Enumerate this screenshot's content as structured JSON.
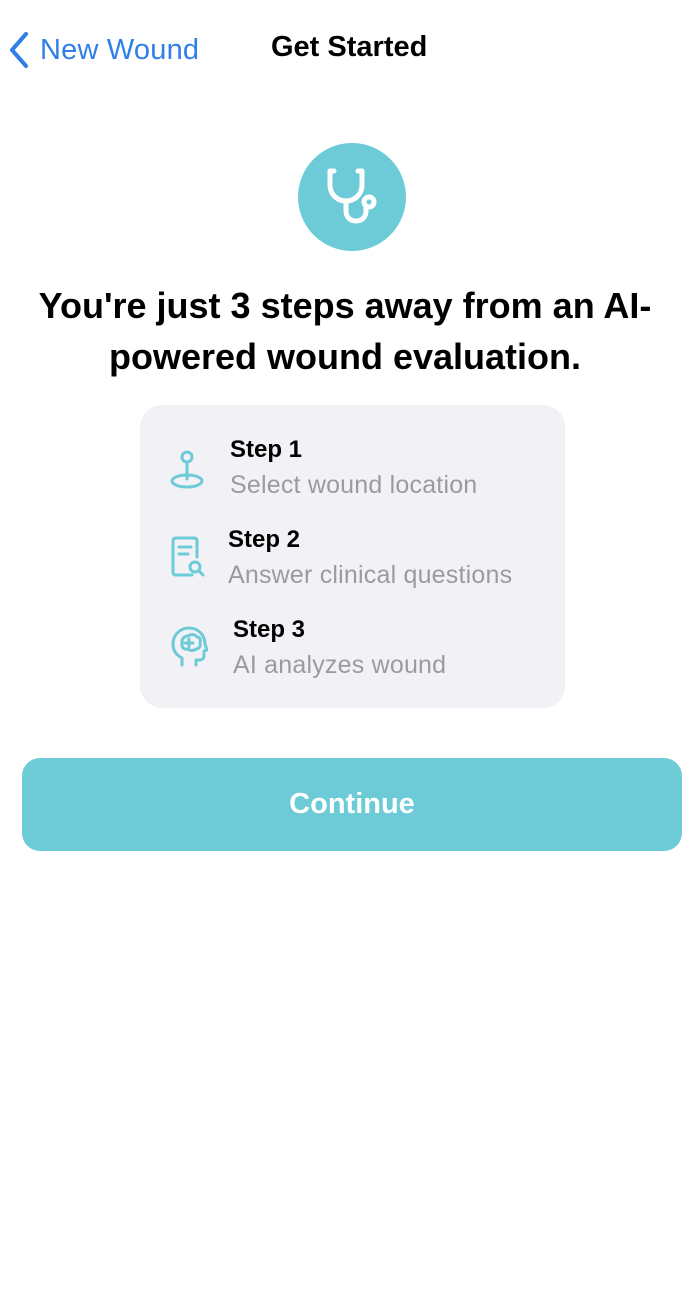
{
  "nav": {
    "back_label": "New Wound",
    "title": "Get Started"
  },
  "hero": {
    "icon": "stethoscope-icon"
  },
  "headline": {
    "line1": "You're just 3 steps away from an AI-",
    "line2": "powered wound evaluation."
  },
  "steps": [
    {
      "title": "Step 1",
      "description": "Select wound location",
      "icon": "location-pin-icon"
    },
    {
      "title": "Step 2",
      "description": "Answer clinical questions",
      "icon": "document-search-icon"
    },
    {
      "title": "Step 3",
      "description": "AI analyzes wound",
      "icon": "brain-head-icon"
    }
  ],
  "continue_label": "Continue",
  "colors": {
    "accent": "#6ccbd7",
    "link": "#2f7fe6",
    "card_bg": "#f2f2f6",
    "secondary_text": "#9a9aa0"
  }
}
